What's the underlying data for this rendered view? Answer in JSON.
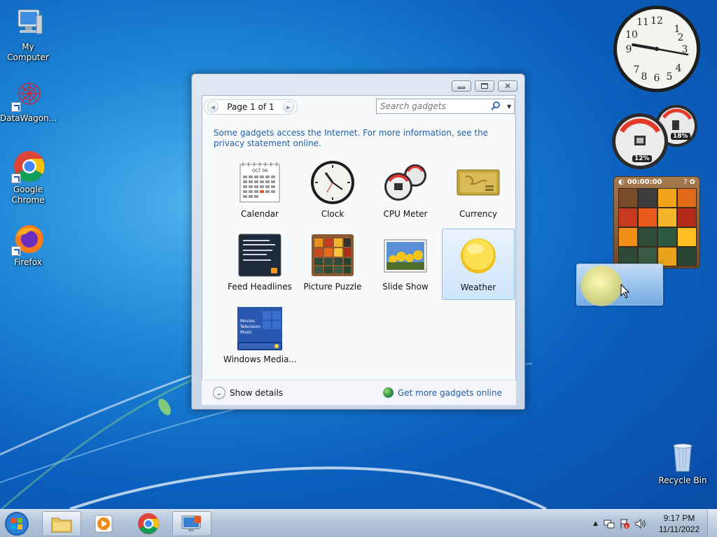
{
  "desktop": {
    "icons": [
      {
        "label": "My Computer"
      },
      {
        "label": "DataWagon..."
      },
      {
        "label": "Google Chrome"
      },
      {
        "label": "Firefox"
      },
      {
        "label": "Recycle Bin"
      }
    ]
  },
  "gadget_window": {
    "page_label": "Page 1 of 1",
    "search_placeholder": "Search gadgets",
    "notice": "Some gadgets access the Internet.  For more information, see the privacy statement online.",
    "gadgets": [
      {
        "name": "Calendar"
      },
      {
        "name": "Clock"
      },
      {
        "name": "CPU Meter"
      },
      {
        "name": "Currency"
      },
      {
        "name": "Feed Headlines"
      },
      {
        "name": "Picture Puzzle"
      },
      {
        "name": "Slide Show"
      },
      {
        "name": "Weather",
        "selected": true
      },
      {
        "name": "Windows Media..."
      }
    ],
    "calendar_month": "OCT 06",
    "show_details": "Show details",
    "get_more": "Get more gadgets online",
    "media_lines": [
      "Movies",
      "Television",
      "Music"
    ]
  },
  "desktop_gadgets": {
    "cpu_percent": "12%",
    "mem_percent": "18%",
    "puzzle_timer": "00:00:00"
  },
  "taskbar": {
    "time": "9:17 PM",
    "date": "11/11/2022"
  },
  "colors": {
    "accent": "#1f5eaa",
    "desktop_blue": "#0b5fbe"
  }
}
